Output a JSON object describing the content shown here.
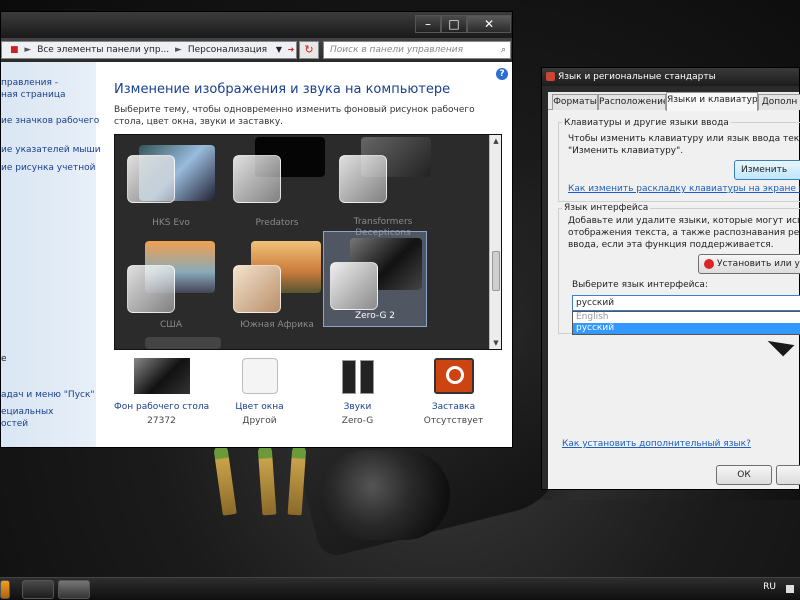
{
  "control_panel": {
    "address": {
      "segment1": "Все элементы панели упр...",
      "segment2": "Персонализация"
    },
    "search_placeholder": "Поиск в панели управления",
    "sidebar": {
      "link1_line1": "правления -",
      "link1_line2": "ная страница",
      "link2": "ие значков рабочего",
      "link3": "ие указателей мыши",
      "link4": "ие рисунка учетной",
      "see_also": "е",
      "link5": "адач и меню \"Пуск\"",
      "link6_line1": "ециальных",
      "link6_line2": "остей"
    },
    "title": "Изменение изображения и звука на компьютере",
    "description": "Выберите тему, чтобы одновременно изменить фоновый рисунок рабочего стола, цвет окна, звуки и заставку.",
    "themes": [
      {
        "name": "HKS Evo"
      },
      {
        "name": "Predators"
      },
      {
        "name": "Transformers Decepticons"
      },
      {
        "name": "США"
      },
      {
        "name": "Южная Африка"
      },
      {
        "name": "Zero-G 2",
        "selected": true
      }
    ],
    "bottom": {
      "background": {
        "label": "Фон рабочего стола",
        "value": "27372"
      },
      "color": {
        "label": "Цвет окна",
        "value": "Другой"
      },
      "sounds": {
        "label": "Звуки",
        "value": "Zero-G"
      },
      "screensaver": {
        "label": "Заставка",
        "value": "Отсутствует"
      }
    }
  },
  "region": {
    "title": "Язык и региональные стандарты",
    "tabs": [
      "Форматы",
      "Расположение",
      "Языки и клавиатуры",
      "Дополн"
    ],
    "keyboards": {
      "title": "Клавиатуры и другие языки ввода",
      "text_line1": "Чтобы изменить клавиатуру или язык ввода текста, на",
      "text_line2": "\"Изменить клавиатуру\".",
      "button": "Изменить",
      "link": "Как изменить раскладку клавиатуры на экране привет"
    },
    "interface": {
      "title": "Язык интерфейса",
      "text_line1": "Добавьте или удалите языки, которые могут использ",
      "text_line2": "отображения текста, а также распознавания речи и р",
      "text_line3": "ввода, если эта функция поддерживается.",
      "install_button": "Установить или у",
      "choose_label": "Выберите язык интерфейса:",
      "selected": "русский",
      "options": [
        "English",
        "русский"
      ]
    },
    "help_link": "Как установить дополнительный язык?",
    "ok": "ОК"
  },
  "taskbar": {
    "lang": "RU"
  }
}
